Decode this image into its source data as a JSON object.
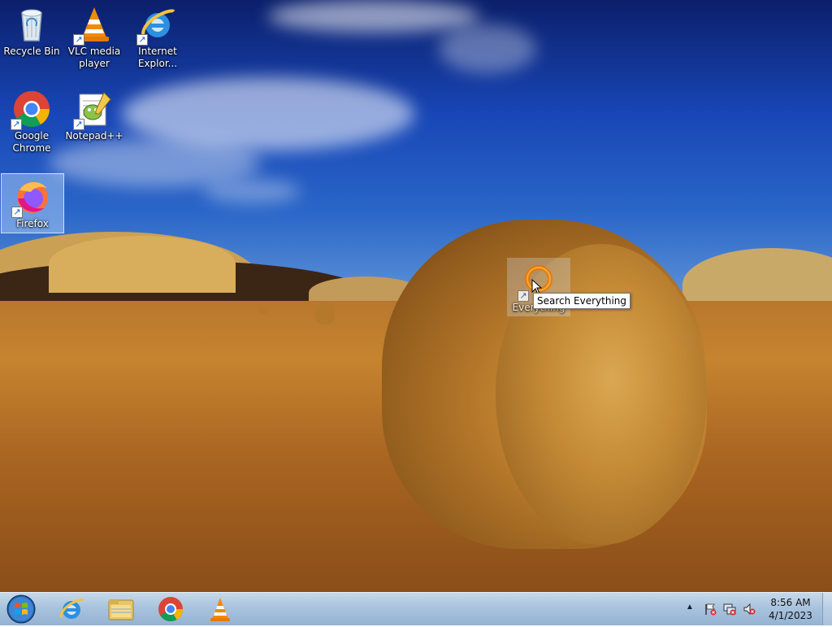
{
  "desktop": {
    "icons": [
      {
        "label": "Recycle Bin",
        "icon": "recycle-bin-icon",
        "shortcut": false
      },
      {
        "label": "VLC media player",
        "icon": "vlc-icon",
        "shortcut": true
      },
      {
        "label": "Internet Explor...",
        "icon": "internet-explorer-icon",
        "shortcut": true
      },
      {
        "label": "Google Chrome",
        "icon": "chrome-icon",
        "shortcut": true
      },
      {
        "label": "Notepad++",
        "icon": "notepad-plus-plus-icon",
        "shortcut": true
      },
      {
        "label": "Firefox",
        "icon": "firefox-icon",
        "shortcut": true,
        "selected": true
      },
      {
        "label": "Everything",
        "icon": "everything-search-icon",
        "shortcut": true,
        "dragging": true
      }
    ],
    "tooltip": "Search Everything"
  },
  "taskbar": {
    "pinned": [
      {
        "name": "Internet Explorer",
        "icon": "internet-explorer-icon"
      },
      {
        "name": "Windows Explorer",
        "icon": "folder-icon"
      },
      {
        "name": "Google Chrome",
        "icon": "chrome-icon"
      },
      {
        "name": "VLC media player",
        "icon": "vlc-icon"
      }
    ],
    "tray": {
      "show_hidden_glyph": "▲",
      "icons": [
        "action-center-flag-icon",
        "network-disconnected-icon",
        "volume-muted-icon"
      ]
    },
    "clock": {
      "time": "8:56 AM",
      "date": "4/1/2023"
    }
  },
  "colors": {
    "sky": "#1846b6",
    "field": "#b8772d",
    "taskbar": "#a9c3dd",
    "selection": "#bedcff"
  }
}
